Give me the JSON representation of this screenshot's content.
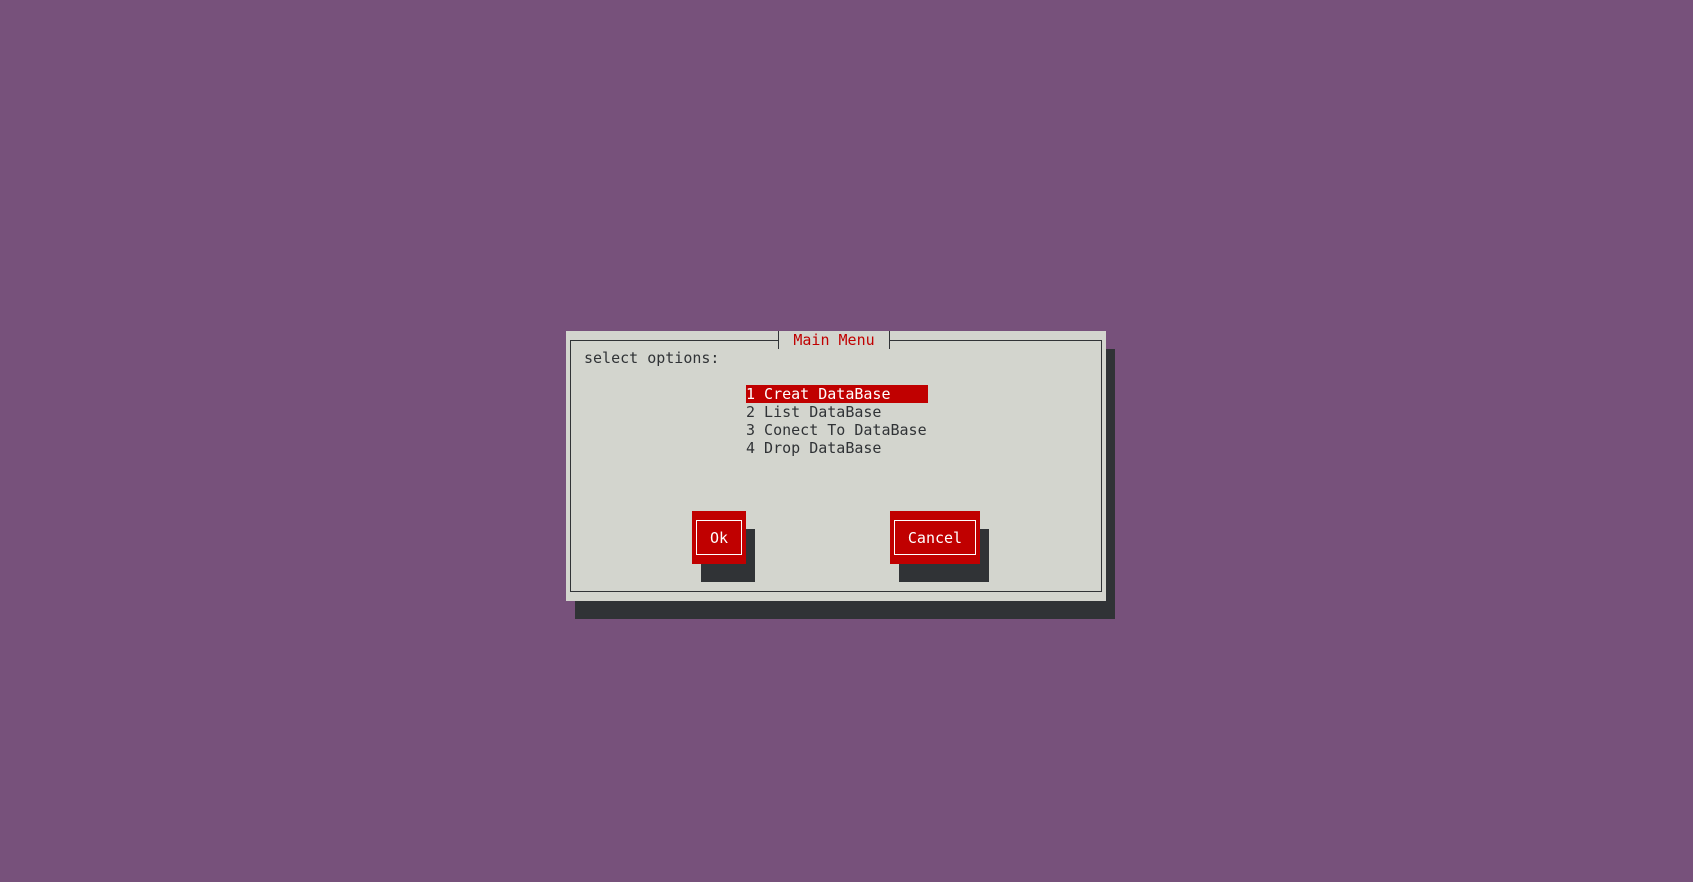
{
  "dialog": {
    "title": "Main Menu",
    "prompt": "select options:",
    "menu_items": [
      {
        "label": "1 Creat DataBase",
        "selected": true
      },
      {
        "label": "2 List DataBase",
        "selected": false
      },
      {
        "label": "3 Conect To DataBase",
        "selected": false
      },
      {
        "label": "4 Drop DataBase",
        "selected": false
      }
    ],
    "buttons": {
      "ok_label": "Ok",
      "cancel_label": "Cancel"
    }
  },
  "colors": {
    "desktop_background": "#77517b",
    "dialog_background": "#d3d5ce",
    "accent": "#c00000",
    "shadow": "#303336",
    "text": "#303336"
  }
}
